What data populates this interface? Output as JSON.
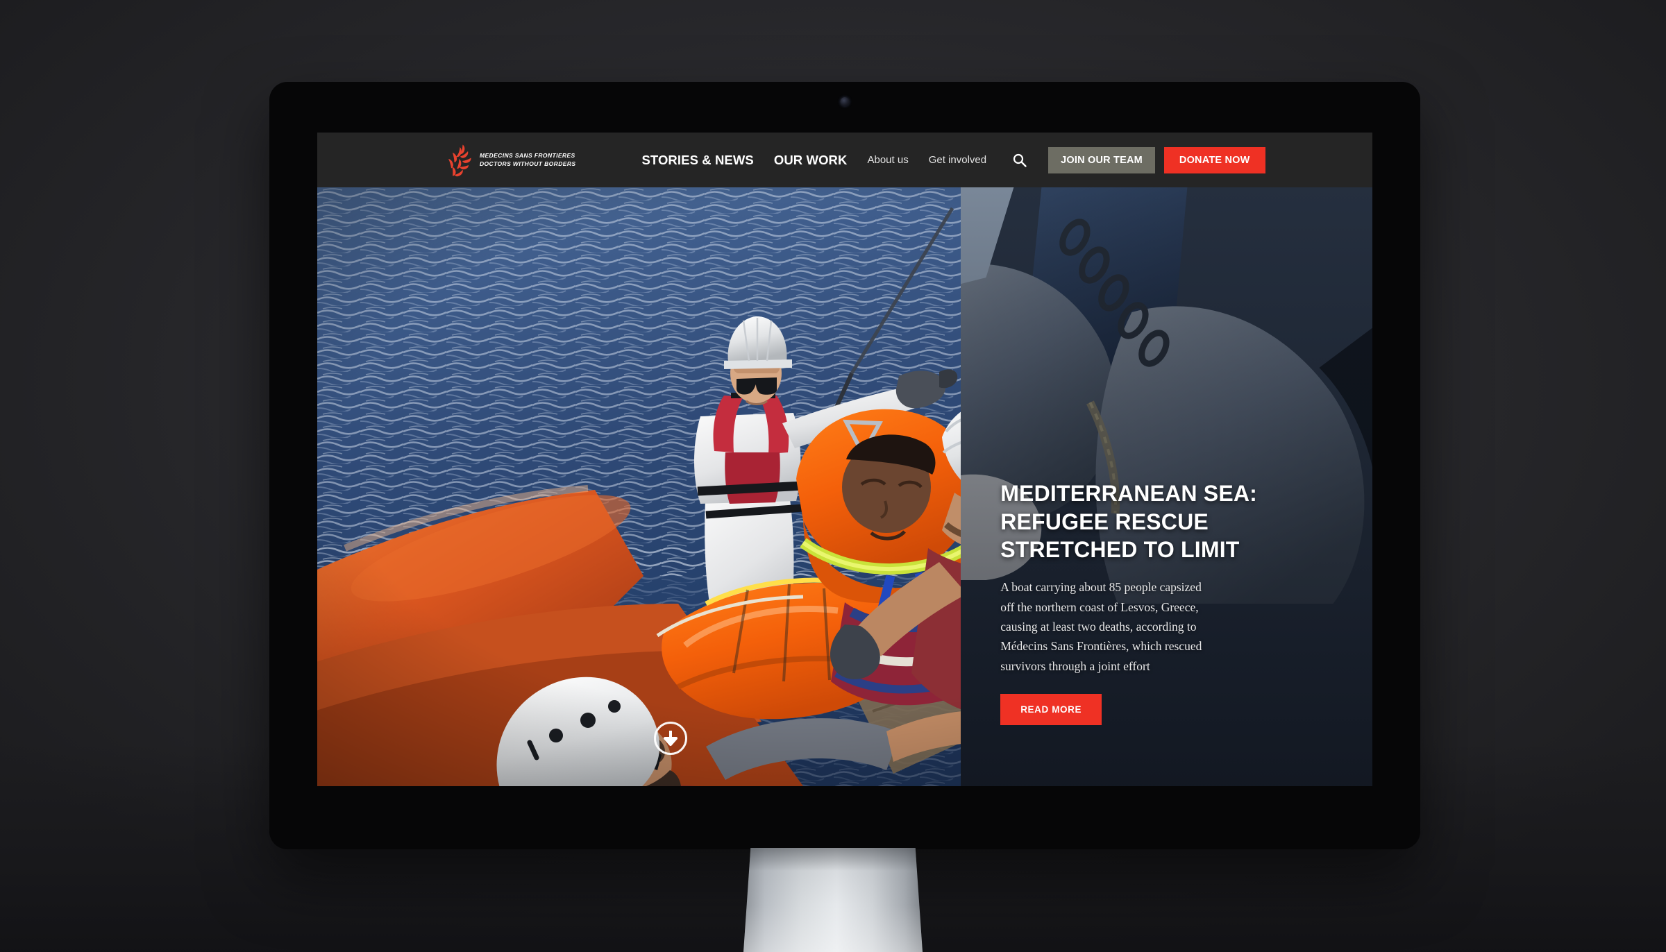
{
  "device": {
    "type": "desktop-monitor",
    "bezel_color": "#060607",
    "backdrop_color": "#2a2a2e",
    "stand_color": "#d6dadd"
  },
  "site": {
    "logo": {
      "name": "msf-logo",
      "line1": "MEDECINS SANS FRONTIERES",
      "line2": "DOCTORS WITHOUT BORDERS",
      "mark_color": "#e8422e"
    },
    "nav": {
      "primary": [
        {
          "label": "STORIES & NEWS",
          "name": "nav-stories-news"
        },
        {
          "label": "OUR WORK",
          "name": "nav-our-work"
        }
      ],
      "secondary": [
        {
          "label": "About us",
          "name": "nav-about-us"
        },
        {
          "label": "Get involved",
          "name": "nav-get-involved"
        }
      ],
      "search_icon": "search-icon",
      "buttons": {
        "join": {
          "label": "JOIN OUR TEAM",
          "color": "#6d6d63"
        },
        "donate": {
          "label": "DONATE NOW",
          "color": "#ef3124"
        }
      }
    },
    "hero": {
      "title": "MEDITERRANEAN SEA: REFUGEE RESCUE STRETCHED TO LIMIT",
      "body": "A boat carrying about 85 people capsized off the northern coast of Lesvos, Greece, causing at least two deaths, according to Médecins Sans Frontières, which rescued survivors through a joint effort",
      "read_more_label": "READ MORE",
      "read_more_color": "#ef3124",
      "scroll_hint_icon": "arrow-down-icon",
      "photo_description": "Rescue workers in white helmets lifting a child wearing an orange life vest from an orange inflatable boat on the deep blue Mediterranean Sea"
    }
  }
}
